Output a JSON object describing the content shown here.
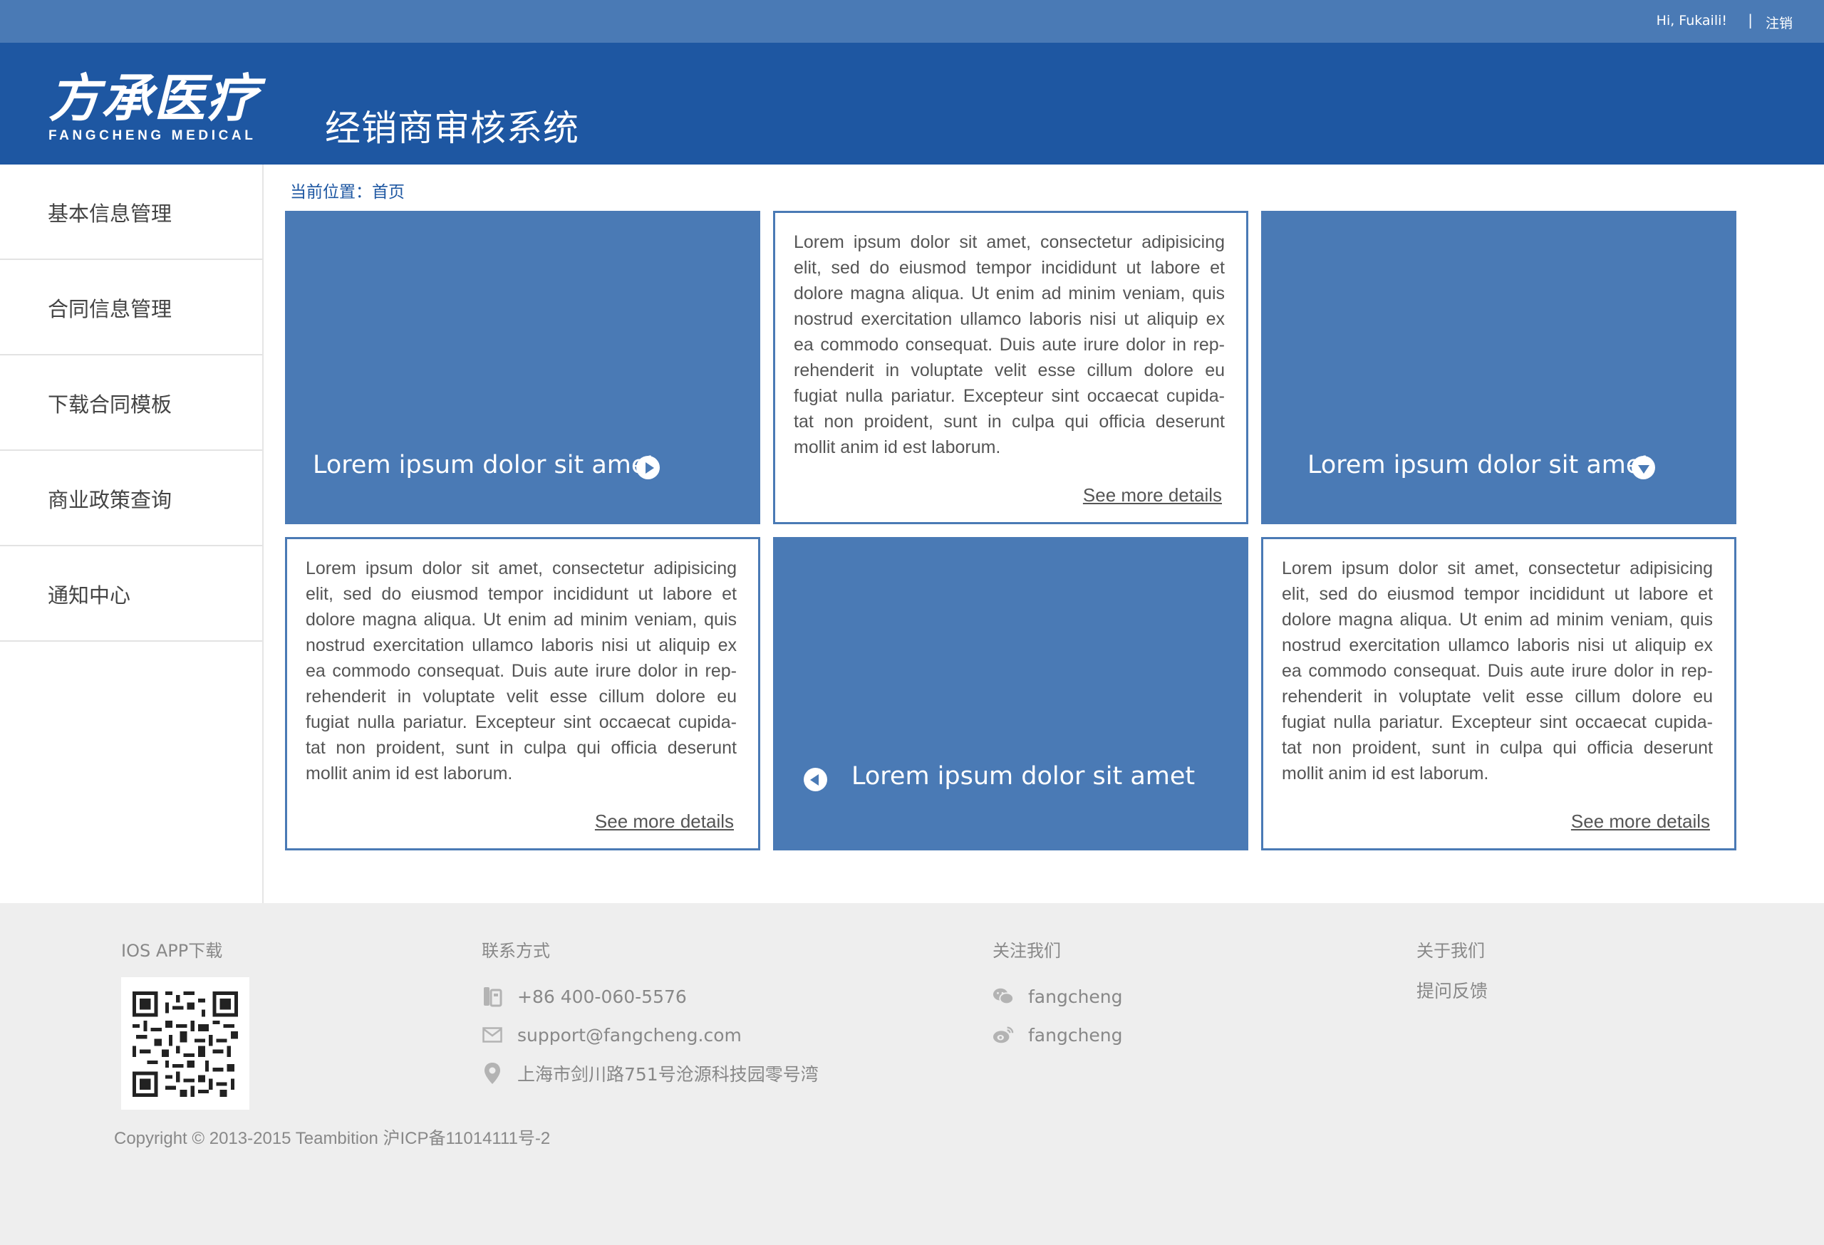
{
  "topbar": {
    "greeting": "Hi, Fukaili!",
    "separator": "|",
    "logout": "注销"
  },
  "header": {
    "logo_cn": "方承医疗",
    "logo_en": "FANGCHENG  MEDICAL",
    "system_title": "经销商审核系统"
  },
  "sidebar": {
    "items": [
      {
        "label": "基本信息管理"
      },
      {
        "label": "合同信息管理"
      },
      {
        "label": "下载合同模板"
      },
      {
        "label": "商业政策查询"
      },
      {
        "label": "通知中心"
      }
    ]
  },
  "breadcrumb": "当前位置：首页",
  "cards": {
    "c1_title": "Lorem ipsum dolor sit amet",
    "c2_body": "Lorem ipsum dolor sit amet, consectetur adipisicing elit, sed do eiusmod tempor incididunt ut labore et dolore magna aliqua. Ut enim ad minim veniam, quis nostrud exercitation ullamco laboris nisi ut aliquip ex ea commodo consequat. Duis aute irure dolor in rep-rehenderit in voluptate velit esse cillum dolore eu fugiat nulla pariatur. Excepteur sint occaecat cupida-tat non proident, sunt in culpa qui officia deserunt mollit anim id est laborum.",
    "c2_more": "See more details",
    "c3_title": "Lorem ipsum dolor sit amet",
    "c4_body": "Lorem ipsum dolor sit amet, consectetur adipisicing elit, sed do eiusmod tempor incididunt ut labore et dolore magna aliqua. Ut enim ad minim veniam, quis nostrud exercitation ullamco laboris nisi ut aliquip ex ea commodo consequat. Duis aute irure dolor in rep-rehenderit in voluptate velit esse cillum dolore eu fugiat nulla pariatur. Excepteur sint occaecat cupida-tat non proident, sunt in culpa qui officia deserunt mollit anim id est laborum.",
    "c4_more": "See more details",
    "c5_title": "Lorem ipsum dolor sit amet",
    "c6_body": "Lorem ipsum dolor sit amet, consectetur adipisicing elit, sed do eiusmod tempor incididunt ut labore et dolore magna aliqua. Ut enim ad minim veniam, quis nostrud exercitation ullamco laboris nisi ut aliquip ex ea commodo consequat. Duis aute irure dolor in rep-rehenderit in voluptate velit esse cillum dolore eu fugiat nulla pariatur. Excepteur sint occaecat cupida-tat non proident, sunt in culpa qui officia deserunt mollit anim id est laborum.",
    "c6_more": "See more details"
  },
  "footer": {
    "ios_heading": "IOS APP下载",
    "contact_heading": "联系方式",
    "phone": "+86 400-060-5576",
    "email": "support@fangcheng.com",
    "address": "上海市剑川路751号沧源科技园零号湾",
    "follow_heading": "关注我们",
    "wechat": "fangcheng",
    "weibo": "fangcheng",
    "about_heading": "关于我们",
    "feedback": "提问反馈",
    "copyright": "Copyright © 2013-2015 Teambition 沪ICP备11014111号-2"
  },
  "colors": {
    "primary": "#1e57a2",
    "accent": "#4a7ab5",
    "footer_bg": "#eeeeee"
  },
  "icons": [
    "qr-code-icon",
    "phone-icon",
    "mail-icon",
    "location-icon",
    "wechat-icon",
    "weibo-icon"
  ]
}
